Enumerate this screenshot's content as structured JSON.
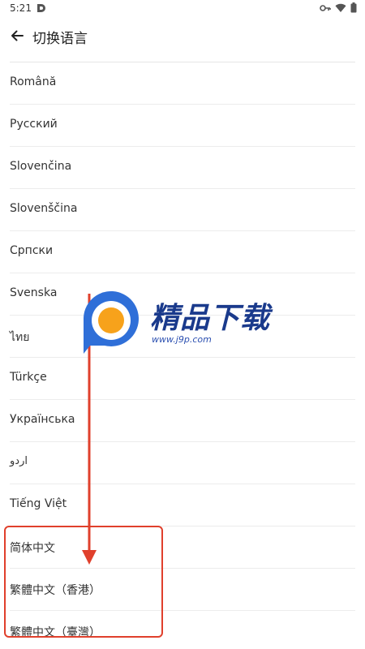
{
  "status_bar": {
    "time": "5:21",
    "icons": [
      "app-notification-icon",
      "vpn-key-icon",
      "wifi-icon",
      "battery-icon"
    ]
  },
  "toolbar": {
    "back_icon": "arrow-left-icon",
    "title": "切换语言"
  },
  "languages": [
    {
      "label": "Română"
    },
    {
      "label": "Русский"
    },
    {
      "label": "Slovenčina"
    },
    {
      "label": "Slovenščina"
    },
    {
      "label": "Српски"
    },
    {
      "label": "Svenska"
    },
    {
      "label": "ไทย"
    },
    {
      "label": "Türkçe"
    },
    {
      "label": "Українська"
    },
    {
      "label": "اردو"
    },
    {
      "label": "Tiếng Việt"
    },
    {
      "label": "简体中文"
    },
    {
      "label": "繁體中文（香港）"
    },
    {
      "label": "繁體中文（臺灣）"
    }
  ],
  "annotation": {
    "color": "#e0402c",
    "highlighted_items": [
      "简体中文",
      "繁體中文（香港）",
      "繁體中文（臺灣）"
    ]
  },
  "watermark": {
    "name": "精品下载",
    "url": "www.j9p.com",
    "colors": {
      "blue": "#2f6fd8",
      "orange": "#f7a21b"
    }
  }
}
